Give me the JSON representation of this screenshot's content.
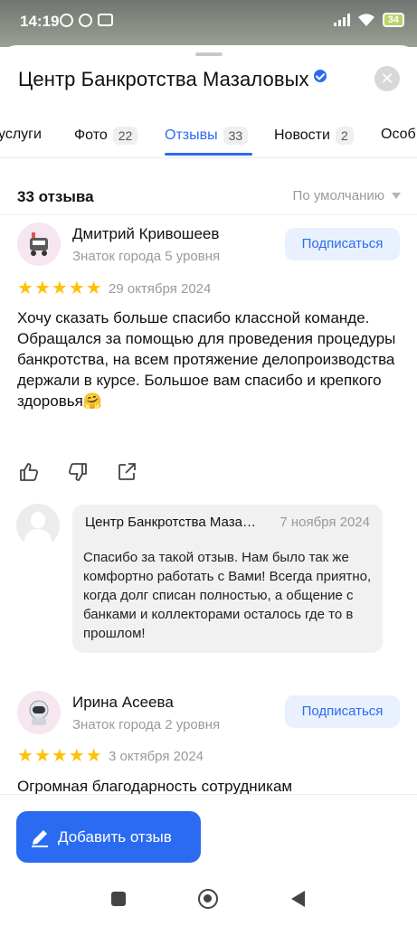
{
  "status_bar": {
    "time": "14:19",
    "battery": "34"
  },
  "header": {
    "title": "Центр Банкротства Мазаловых"
  },
  "tabs": [
    {
      "label": "услуги",
      "count": ""
    },
    {
      "label": "Фото",
      "count": "22"
    },
    {
      "label": "Отзывы",
      "count": "33"
    },
    {
      "label": "Новости",
      "count": "2"
    },
    {
      "label": "Особ",
      "count": ""
    }
  ],
  "reviews_header": {
    "count_label": "33 отзыва",
    "sort_label": "По умолчанию"
  },
  "reviews": [
    {
      "author": "Дмитрий Кривошеев",
      "level": "Знаток города 5 уровня",
      "subscribe": "Подписаться",
      "rating": 5,
      "date": "29 октября 2024",
      "text": [
        "Хочу сказать больше спасибо классной команде.",
        "Обращался за помощью для проведения процедуры банкротства, на всем протяжение делопроизводства держали в курсе.  Большое вам спасибо и крепкого здоровья🤗"
      ],
      "reply": {
        "author": "Центр Банкротства Мазаловых",
        "date": "7 ноября 2024",
        "text": "Спасибо за такой отзыв. Нам было так же комфортно работать с Вами! Всегда приятно, когда долг списан полностью, а общение с банками и коллекторами осталось где то в прошлом!"
      }
    },
    {
      "author": "Ирина Асеева",
      "level": "Знаток города 2 уровня",
      "subscribe": "Подписаться",
      "rating": 5,
      "date": "3 октября 2024",
      "text": [
        "Огромная благодарность сотрудникам"
      ]
    }
  ],
  "add_review_button": "Добавить отзыв",
  "colors": {
    "accent": "#2a6bf2",
    "star": "#ffc107",
    "subscribe_bg": "#e9f1fe"
  }
}
